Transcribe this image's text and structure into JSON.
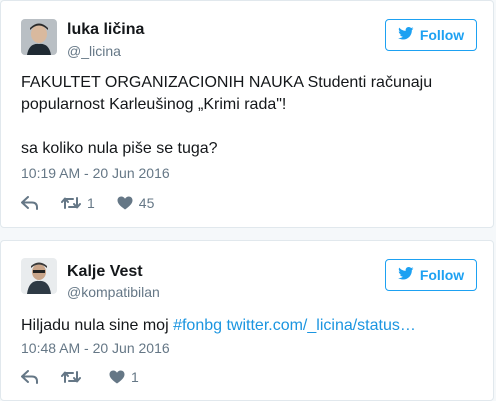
{
  "tweets": [
    {
      "name": "luka ličina",
      "handle": "@_licina",
      "follow_label": "Follow",
      "text_line1": "FAKULTET ORGANIZACIONIH NAUKA Studenti računaju",
      "text_line2": "popularnost Karleušinog „Krimi rada\"!",
      "text_line3": "sa koliko nula piše se tuga?",
      "timestamp": "10:19 AM - 20 Jun 2016",
      "retweets": "1",
      "likes": "45"
    },
    {
      "name": "Kalje Vest",
      "handle": "@kompatibilan",
      "follow_label": "Follow",
      "text_plain": "Hiljadu nula sine moj ",
      "text_hashtag": "#fonbg",
      "text_link": "twitter.com/_licina/status…",
      "timestamp": "10:48 AM - 20 Jun 2016",
      "retweets": "",
      "likes": "1"
    }
  ],
  "colors": {
    "accent": "#1da1f2",
    "link": "#1b95e0",
    "muted": "#657786",
    "text": "#14171a",
    "border": "#e1e8ed",
    "background": "#f5f8fa"
  },
  "icons": [
    "twitter-bird-icon",
    "reply-icon",
    "retweet-icon",
    "heart-icon"
  ]
}
